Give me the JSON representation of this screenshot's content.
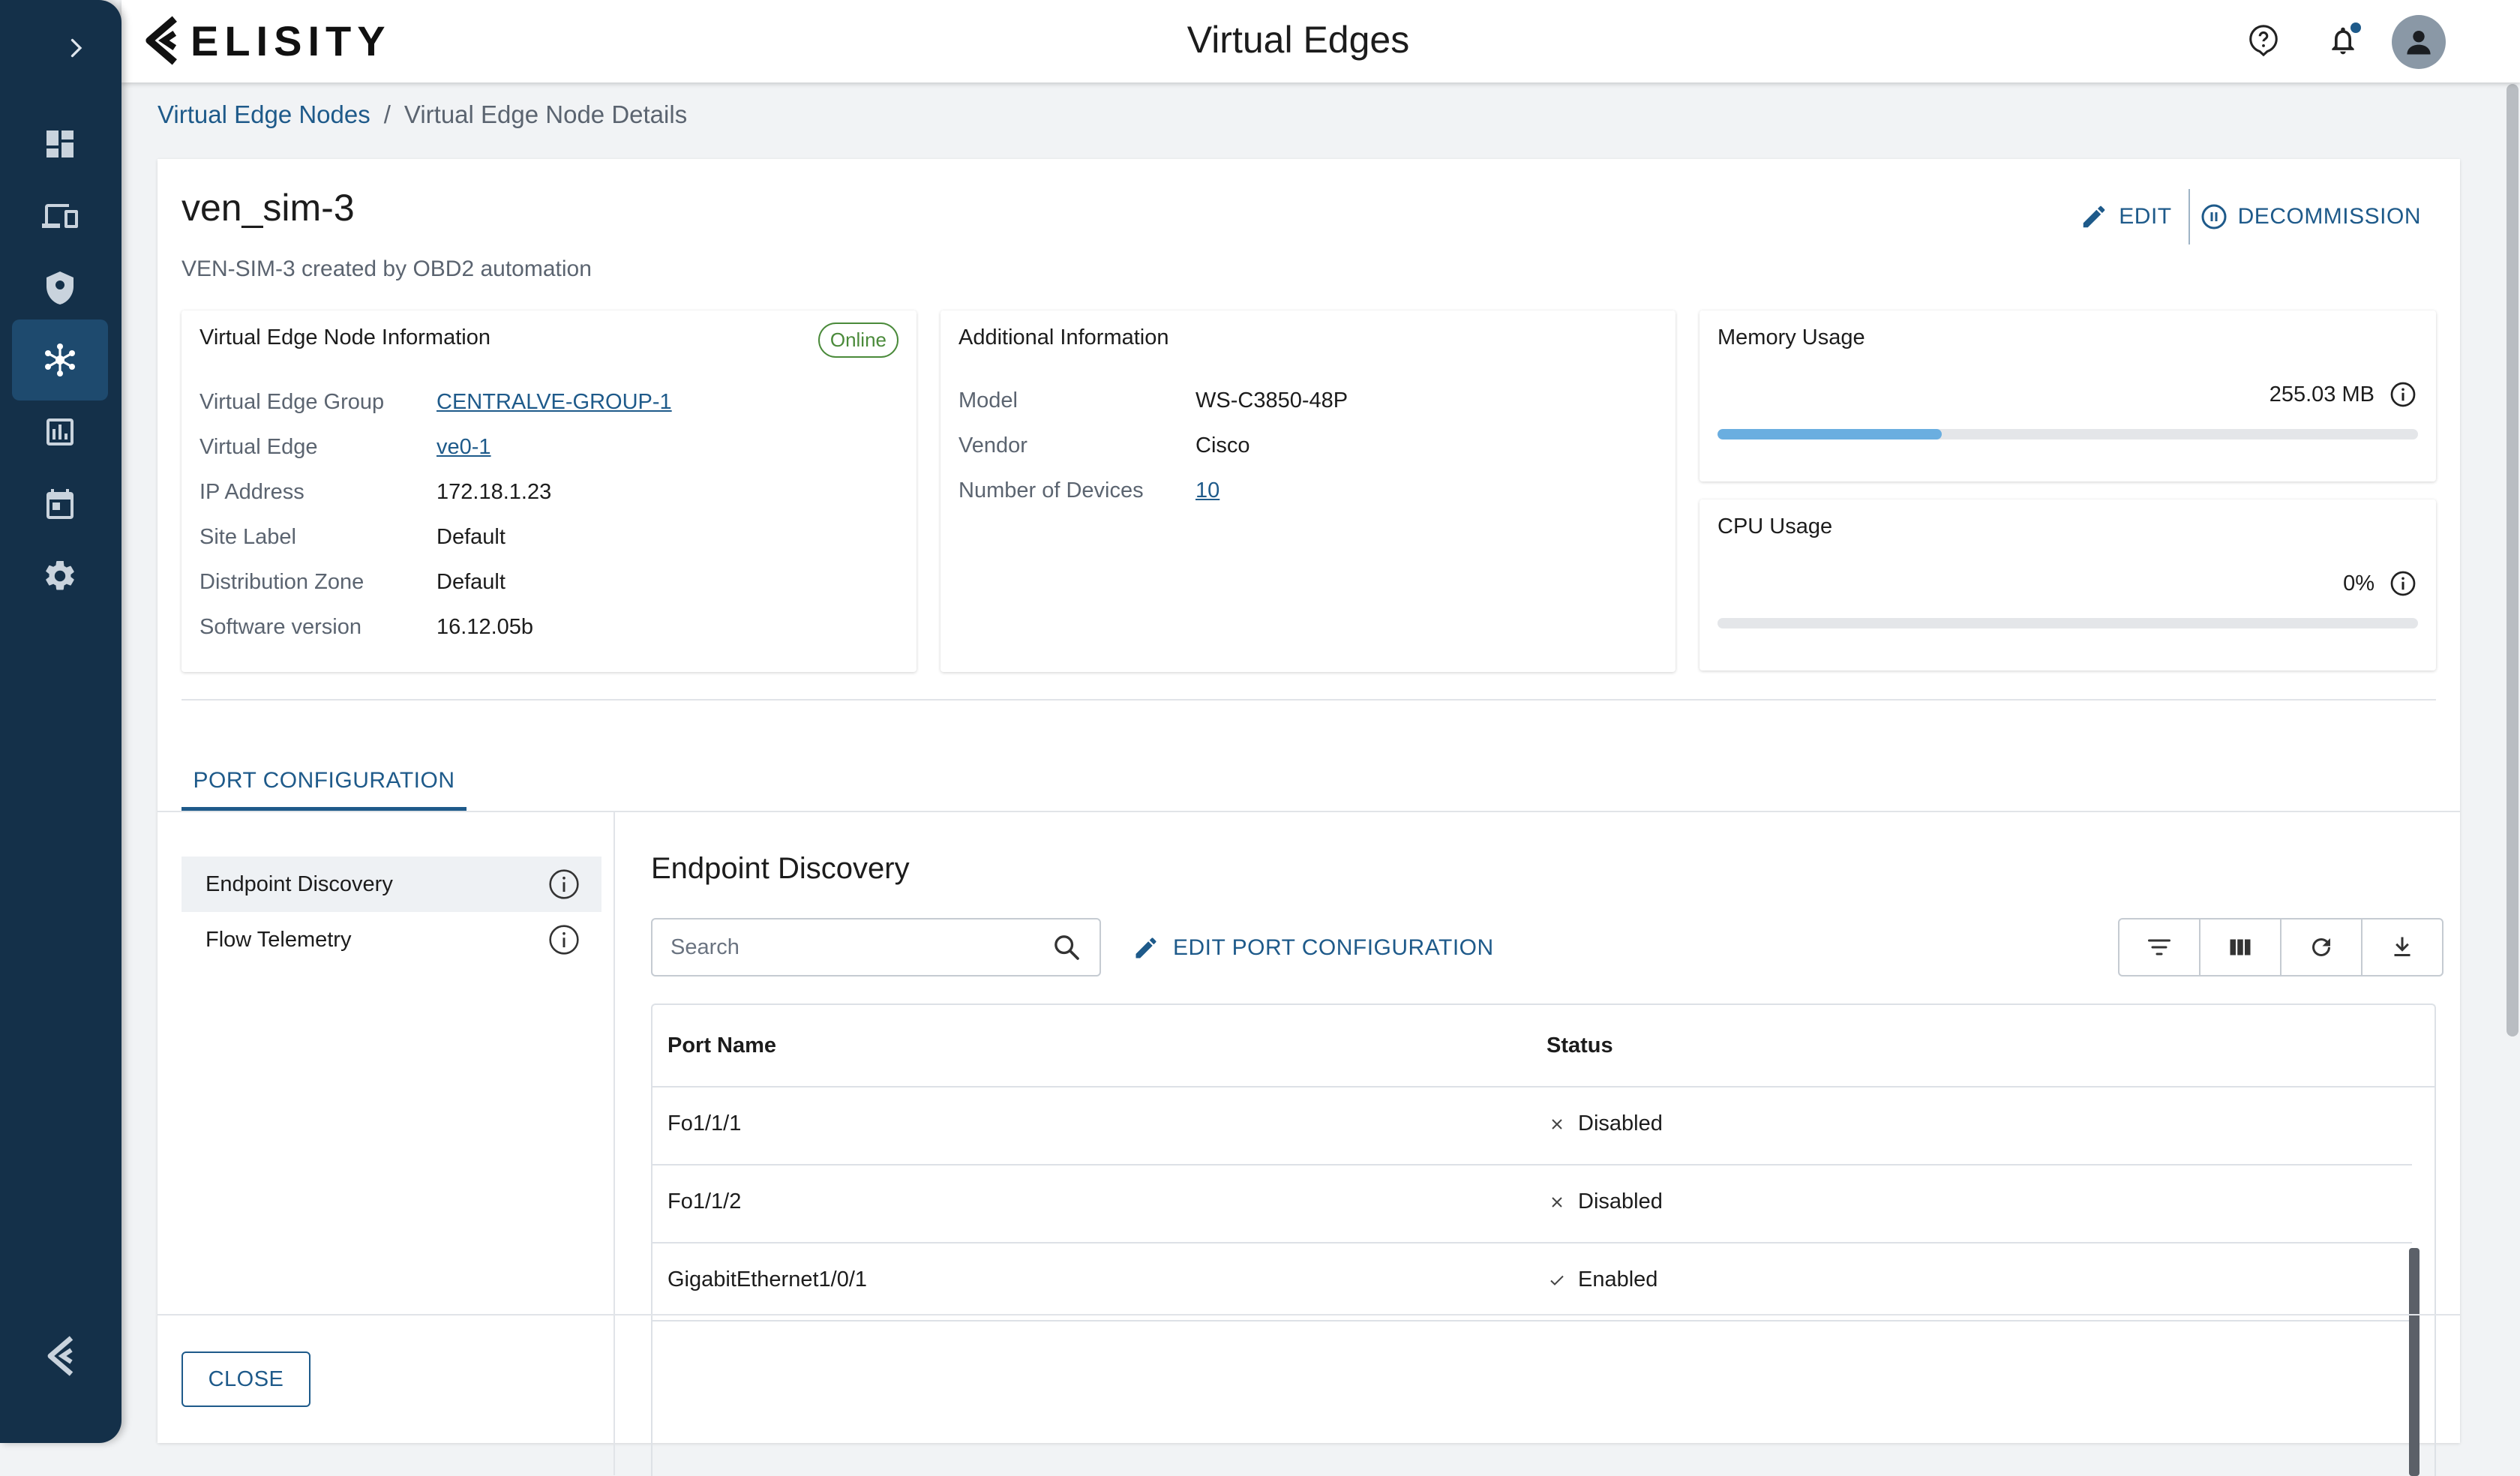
{
  "app": {
    "brand": "ELISITY",
    "title": "Virtual Edges"
  },
  "sidebar": {
    "items": [
      {
        "name": "dashboard-icon",
        "active": false
      },
      {
        "name": "devices-icon",
        "active": false
      },
      {
        "name": "policy-shield-icon",
        "active": false
      },
      {
        "name": "network-topology-icon",
        "active": true
      },
      {
        "name": "analytics-icon",
        "active": false
      },
      {
        "name": "calendar-icon",
        "active": false
      },
      {
        "name": "settings-gear-icon",
        "active": false
      }
    ]
  },
  "breadcrumb": {
    "parent": "Virtual Edge Nodes",
    "separator": "/",
    "current": "Virtual Edge Node Details"
  },
  "node": {
    "name": "ven_sim-3",
    "description": "VEN-SIM-3 created by OBD2 automation",
    "edit_label": "EDIT",
    "decommission_label": "DECOMMISSION"
  },
  "info_panel": {
    "title": "Virtual Edge Node Information",
    "status": "Online",
    "rows": [
      {
        "label": "Virtual Edge Group",
        "value": "CENTRALVE-GROUP-1"
      },
      {
        "label": "Virtual Edge",
        "value": "ve0-1"
      },
      {
        "label": "IP Address",
        "value": "172.18.1.23"
      },
      {
        "label": "Site Label",
        "value": "Default"
      },
      {
        "label": "Distribution Zone",
        "value": "Default"
      },
      {
        "label": "Software version",
        "value": "16.12.05b"
      }
    ]
  },
  "additional_panel": {
    "title": "Additional Information",
    "rows": [
      {
        "label": "Model",
        "value": "WS-C3850-48P"
      },
      {
        "label": "Vendor",
        "value": "Cisco"
      },
      {
        "label": "Number of Devices",
        "value": "10"
      }
    ]
  },
  "memory": {
    "title": "Memory Usage",
    "value": "255.03 MB",
    "fraction": 0.32
  },
  "cpu": {
    "title": "CPU Usage",
    "value": "0%",
    "fraction": 0
  },
  "tabs": [
    {
      "label": "PORT CONFIGURATION",
      "active": true
    }
  ],
  "side_menu": {
    "items": [
      {
        "label": "Endpoint Discovery",
        "active": true
      },
      {
        "label": "Flow Telemetry",
        "active": false
      }
    ]
  },
  "endpoint_discovery": {
    "title": "Endpoint Discovery",
    "search_placeholder": "Search",
    "edit_port_label": "EDIT PORT CONFIGURATION",
    "columns": [
      "Port Name",
      "Status"
    ],
    "rows": [
      {
        "port": "Fo1/1/1",
        "status": "Disabled",
        "enabled": false
      },
      {
        "port": "Fo1/1/2",
        "status": "Disabled",
        "enabled": false
      },
      {
        "port": "GigabitEthernet1/0/1",
        "status": "Enabled",
        "enabled": true
      }
    ]
  },
  "footer": {
    "close_label": "CLOSE"
  },
  "colors": {
    "sidebar": "#143049",
    "accent": "#1e5a8a",
    "online": "#4a8a3a",
    "progress": "#6aaee0"
  }
}
